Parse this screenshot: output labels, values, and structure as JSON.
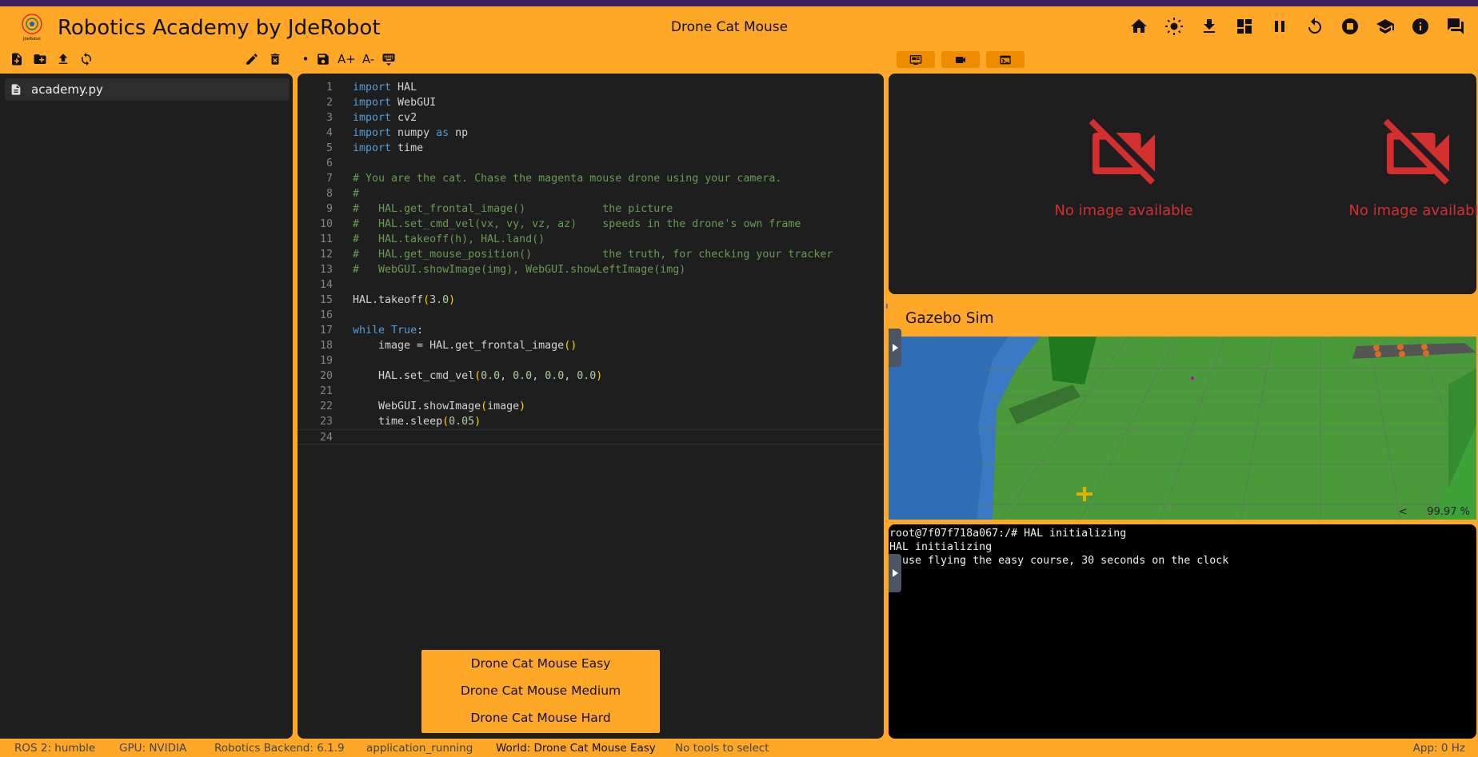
{
  "header": {
    "app_title": "Robotics Academy by JdeRobot",
    "logo_text": "JdeRobot",
    "exercise_name": "Drone Cat Mouse",
    "icons": [
      "home-icon",
      "brightness-icon",
      "download-icon",
      "dashboard-layout-icon",
      "pause-icon",
      "reset-icon",
      "stop-icon",
      "school-icon",
      "info-icon",
      "chat-icon"
    ]
  },
  "file_toolbar": {
    "icons": [
      "new-file-icon",
      "new-folder-icon",
      "upload-icon",
      "refresh-icon",
      "rename-icon",
      "delete-icon"
    ]
  },
  "editor_toolbar": {
    "unsaved_marker": "•",
    "font_increase": "A+",
    "font_decrease": "A-",
    "icons": [
      "save-icon",
      "keyboard-icon"
    ]
  },
  "files": [
    {
      "name": "academy.py",
      "selected": true
    }
  ],
  "code_lines": [
    {
      "n": "1",
      "t": "import HAL"
    },
    {
      "n": "2",
      "t": "import WebGUI"
    },
    {
      "n": "3",
      "t": "import cv2"
    },
    {
      "n": "4",
      "t": "import numpy as np"
    },
    {
      "n": "5",
      "t": "import time"
    },
    {
      "n": "6",
      "t": ""
    },
    {
      "n": "7",
      "t": "# You are the cat. Chase the magenta mouse drone using your camera."
    },
    {
      "n": "8",
      "t": "#"
    },
    {
      "n": "9",
      "t": "#   HAL.get_frontal_image()            the picture"
    },
    {
      "n": "10",
      "t": "#   HAL.set_cmd_vel(vx, vy, vz, az)    speeds in the drone's own frame"
    },
    {
      "n": "11",
      "t": "#   HAL.takeoff(h), HAL.land()"
    },
    {
      "n": "12",
      "t": "#   HAL.get_mouse_position()           the truth, for checking your tracker"
    },
    {
      "n": "13",
      "t": "#   WebGUI.showImage(img), WebGUI.showLeftImage(img)"
    },
    {
      "n": "14",
      "t": ""
    },
    {
      "n": "15",
      "t": "HAL.takeoff(3.0)"
    },
    {
      "n": "16",
      "t": ""
    },
    {
      "n": "17",
      "t": "while True:"
    },
    {
      "n": "18",
      "t": "    image = HAL.get_frontal_image()"
    },
    {
      "n": "19",
      "t": ""
    },
    {
      "n": "20",
      "t": "    HAL.set_cmd_vel(0.0, 0.0, 0.0, 0.0)"
    },
    {
      "n": "21",
      "t": ""
    },
    {
      "n": "22",
      "t": "    WebGUI.showImage(image)"
    },
    {
      "n": "23",
      "t": "    time.sleep(0.05)"
    },
    {
      "n": "24",
      "t": ""
    }
  ],
  "world_menu": [
    "Drone Cat Mouse Easy",
    "Drone Cat Mouse Medium",
    "Drone Cat Mouse Hard"
  ],
  "viewer_tabs": [
    "gui-viewer-icon",
    "video-camera-icon",
    "terminal-icon"
  ],
  "cameras": {
    "left_message": "No image available",
    "right_message": "No image available"
  },
  "gazebo": {
    "title": "Gazebo Sim",
    "rtf": "99.97 %",
    "rtf_toggle": "<"
  },
  "console_lines": [
    "root@7f07f718a067:/# HAL initializing",
    "HAL initializing",
    "mouse flying the easy course, 30 seconds on the clock"
  ],
  "status": {
    "ros": "ROS 2: humble",
    "gpu": "GPU: NVIDIA",
    "backend": "Robotics Backend: 6.1.9",
    "state": "application_running",
    "world": "World: Drone Cat Mouse Easy",
    "tools": "No tools to select",
    "app_rate": "App: 0 Hz"
  },
  "colors": {
    "accent": "#ffa726",
    "panel": "#1e1e1e",
    "error": "#d32f2f"
  }
}
